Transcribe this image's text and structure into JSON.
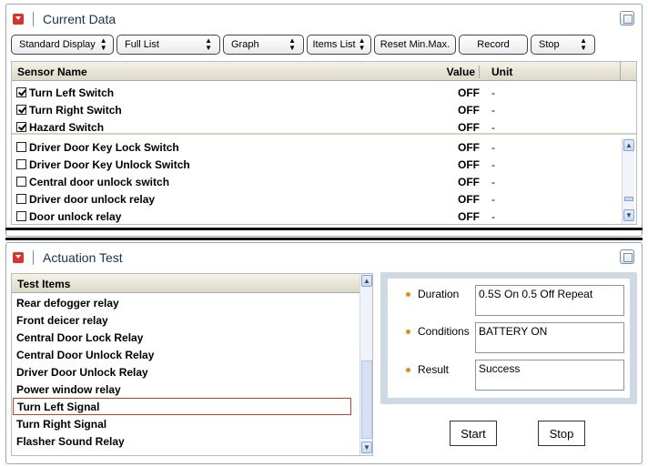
{
  "current_data": {
    "title": "Current Data",
    "toolbar": {
      "display_select": "Standard Display",
      "list_select": "Full List",
      "graph_select": "Graph",
      "items_list_select": "Items List",
      "reset_label": "Reset Min.Max.",
      "record_label": "Record",
      "stop_select": "Stop"
    },
    "columns": {
      "name": "Sensor Name",
      "value": "Value",
      "unit": "Unit"
    },
    "checked_rows": [
      {
        "name": "Turn Left Switch",
        "value": "OFF",
        "unit": "-",
        "checked": true
      },
      {
        "name": "Turn Right Switch",
        "value": "OFF",
        "unit": "-",
        "checked": true
      },
      {
        "name": "Hazard Switch",
        "value": "OFF",
        "unit": "-",
        "checked": true
      }
    ],
    "rows": [
      {
        "name": "Driver Door Key Lock Switch",
        "value": "OFF",
        "unit": "-",
        "checked": false
      },
      {
        "name": "Driver Door Key Unlock Switch",
        "value": "OFF",
        "unit": "-",
        "checked": false
      },
      {
        "name": "Central door unlock switch",
        "value": "OFF",
        "unit": "-",
        "checked": false
      },
      {
        "name": "Driver door unlock relay",
        "value": "OFF",
        "unit": "-",
        "checked": false
      },
      {
        "name": "Door unlock relay",
        "value": "OFF",
        "unit": "-",
        "checked": false
      }
    ]
  },
  "actuation_test": {
    "title": "Actuation Test",
    "list_header": "Test Items",
    "items": [
      "Rear defogger relay",
      "Front deicer relay",
      "Central Door Lock Relay",
      "Central Door Unlock Relay",
      "Driver Door Unlock Relay",
      "Power window relay",
      "Turn Left Signal",
      "Turn Right Signal",
      "Flasher Sound Relay"
    ],
    "selected_item": "Turn Left Signal",
    "duration_label": "Duration",
    "duration_value": "0.5S On 0.5 Off Repeat",
    "conditions_label": "Conditions",
    "conditions_value": "BATTERY ON",
    "result_label": "Result",
    "result_value": "Success",
    "start_label": "Start",
    "stop_label": "Stop"
  },
  "colors": {
    "accent_red": "#d9342b",
    "header_bg": "#e8e5d6",
    "info_bg": "#cfd9e3",
    "bullet": "#e28a1c"
  },
  "icons": [
    "collapse-icon",
    "maximize-icon",
    "checkbox-icon",
    "spinner-icon",
    "scroll-up-icon",
    "scroll-down-icon"
  ]
}
